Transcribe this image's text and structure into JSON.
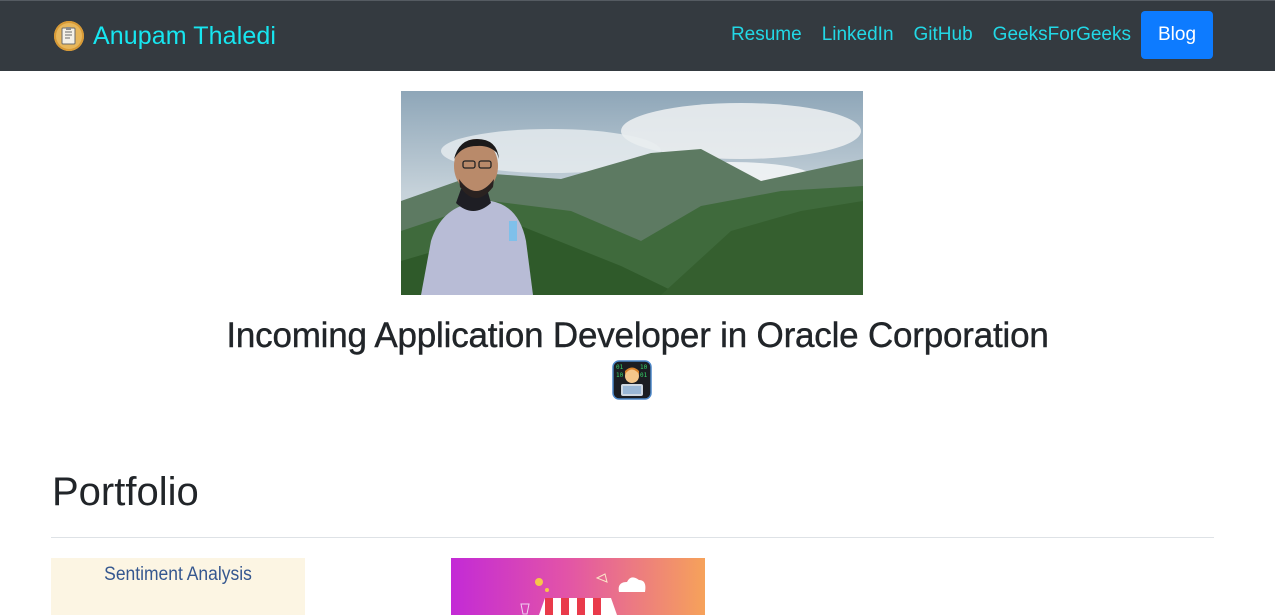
{
  "navbar": {
    "brand_name": "Anupam Thaledi",
    "brand_logo_icon": "notepad-logo-icon",
    "links": [
      {
        "label": "Resume"
      },
      {
        "label": "LinkedIn"
      },
      {
        "label": "GitHub"
      },
      {
        "label": "GeeksForGeeks"
      }
    ],
    "blog_button": "Blog",
    "colors": {
      "background": "#343a40",
      "link": "#22d8e6",
      "button": "#0d7bff"
    }
  },
  "hero": {
    "image": "profile-photo-mountain-landscape",
    "headline": "Incoming Application Developer in Oracle Corporation",
    "emoji_icon": "technologist-icon"
  },
  "portfolio": {
    "title": "Portfolio",
    "cards": [
      {
        "title": "Sentiment Analysis",
        "image": "sentiment-analysis-thumbnail"
      },
      {
        "title": "",
        "image": "online-store-thumbnail"
      }
    ]
  }
}
